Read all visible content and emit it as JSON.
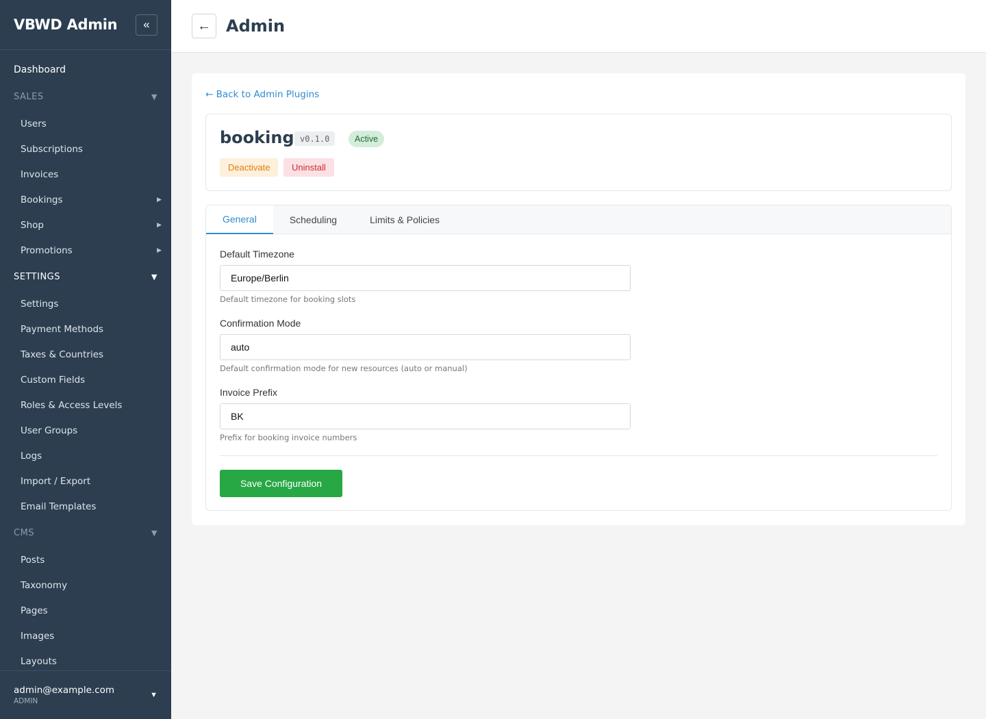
{
  "sidebar": {
    "brand": "VBWD Admin",
    "collapse_icon": "«",
    "dashboard": "Dashboard",
    "sales": {
      "label": "SALES",
      "caret": "▼",
      "items": [
        "Users",
        "Subscriptions",
        "Invoices",
        "Bookings",
        "Shop",
        "Promotions"
      ]
    },
    "settings": {
      "label": "SETTINGS",
      "caret": "▼",
      "items": [
        "Settings",
        "Payment Methods",
        "Taxes & Countries",
        "Custom Fields",
        "Roles & Access Levels",
        "User Groups",
        "Logs",
        "Import / Export",
        "Email Templates"
      ]
    },
    "cms": {
      "label": "CMS",
      "caret": "▼",
      "items": [
        "Posts",
        "Taxonomy",
        "Pages",
        "Images",
        "Layouts"
      ]
    },
    "user": {
      "email": "admin@example.com",
      "role": "ADMIN",
      "caret": "▼"
    }
  },
  "header": {
    "back_icon": "←",
    "title": "Admin"
  },
  "plugin": {
    "back_link": "← Back to Admin Plugins",
    "name": "booking",
    "version": "v0.1.0",
    "status": "Active",
    "deactivate_label": "Deactivate",
    "uninstall_label": "Uninstall"
  },
  "tabs": [
    "General",
    "Scheduling",
    "Limits & Policies"
  ],
  "form": {
    "timezone": {
      "label": "Default Timezone",
      "value": "Europe/Berlin",
      "hint": "Default timezone for booking slots"
    },
    "confirmation": {
      "label": "Confirmation Mode",
      "value": "auto",
      "hint": "Default confirmation mode for new resources (auto or manual)"
    },
    "prefix": {
      "label": "Invoice Prefix",
      "value": "BK",
      "hint": "Prefix for booking invoice numbers"
    },
    "save_label": "Save Configuration"
  },
  "colors": {
    "sidebar_bg": "#2c3e50",
    "accent_blue": "#2f8bd1",
    "save_green": "#28a745",
    "active_badge_bg": "#d4eddb",
    "deactivate_text": "#e67e0f",
    "uninstall_text": "#cc2c36"
  }
}
